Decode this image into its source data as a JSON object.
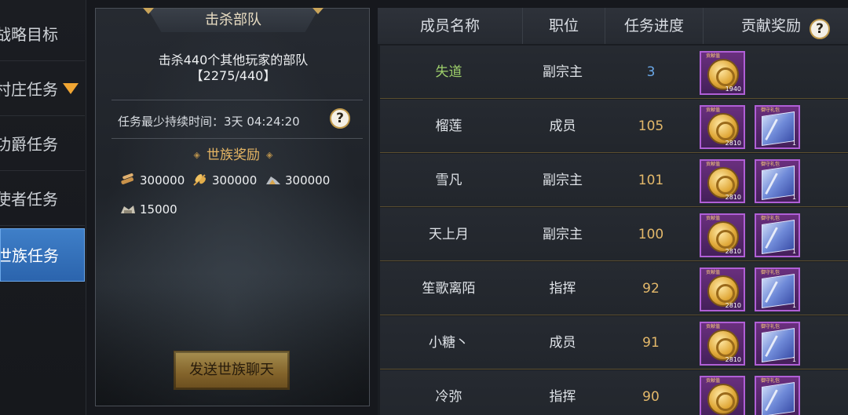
{
  "tabs": [
    {
      "label": "战略目标",
      "active": false
    },
    {
      "label": "村庄任务",
      "active": false,
      "arrow_icon": "dropdown-triangle-icon"
    },
    {
      "label": "功爵任务",
      "active": false
    },
    {
      "label": "使者任务",
      "active": false
    },
    {
      "label": "世族任务",
      "active": true
    }
  ],
  "mission": {
    "title": "击杀部队",
    "description": "击杀440个其他玩家的部队",
    "progress_text": "【2275/440】",
    "duration_text": "任务最少持续时间：3天 04:24:20",
    "help_label": "?",
    "reward_title": "世族奖励",
    "reward_title_ornament": "◈",
    "rewards": [
      {
        "icon": "wood-resource-icon",
        "amount": "300000"
      },
      {
        "icon": "grain-resource-icon",
        "amount": "300000"
      },
      {
        "icon": "stone-resource-icon",
        "amount": "300000"
      },
      {
        "icon": "iron-resource-icon",
        "amount": "15000"
      }
    ],
    "send_button": "发送世族聊天"
  },
  "table": {
    "headers": [
      "成员名称",
      "职位",
      "任务进度",
      "贡献奖励"
    ],
    "help_label": "?",
    "rows": [
      {
        "name": "失道",
        "position": "副宗主",
        "progress": "3",
        "rewards": [
          {
            "icon": "gold-coin-icon",
            "label": "贡献值",
            "count": "1940"
          }
        ]
      },
      {
        "name": "榴莲",
        "position": "成员",
        "progress": "105",
        "rewards": [
          {
            "icon": "gold-coin-icon",
            "label": "贡献值",
            "count": "2810"
          },
          {
            "icon": "gift-book-icon",
            "label": "御守礼包",
            "count": "1"
          }
        ]
      },
      {
        "name": "雪凡",
        "position": "副宗主",
        "progress": "101",
        "rewards": [
          {
            "icon": "gold-coin-icon",
            "label": "贡献值",
            "count": "2810"
          },
          {
            "icon": "gift-book-icon",
            "label": "御守礼包",
            "count": "1"
          }
        ]
      },
      {
        "name": "天上月",
        "position": "副宗主",
        "progress": "100",
        "rewards": [
          {
            "icon": "gold-coin-icon",
            "label": "贡献值",
            "count": "2810"
          },
          {
            "icon": "gift-book-icon",
            "label": "御守礼包",
            "count": "1"
          }
        ]
      },
      {
        "name": "笙歌离陌",
        "position": "指挥",
        "progress": "92",
        "rewards": [
          {
            "icon": "gold-coin-icon",
            "label": "贡献值",
            "count": "2810"
          },
          {
            "icon": "gift-book-icon",
            "label": "御守礼包",
            "count": "1"
          }
        ]
      },
      {
        "name": "小糖丶",
        "position": "成员",
        "progress": "91",
        "rewards": [
          {
            "icon": "gold-coin-icon",
            "label": "贡献值",
            "count": "2810"
          },
          {
            "icon": "gift-book-icon",
            "label": "御守礼包",
            "count": "1"
          }
        ]
      },
      {
        "name": "冷弥",
        "position": "指挥",
        "progress": "90",
        "rewards": [
          {
            "icon": "gold-coin-icon",
            "label": "贡献值",
            "count": ""
          },
          {
            "icon": "gift-book-icon",
            "label": "御守礼包",
            "count": ""
          }
        ]
      }
    ]
  },
  "colors": {
    "active_tab": "#3573bd",
    "gold_text": "#e3b86a",
    "green_name": "#9ed06b",
    "blue_progress": "#6aa7e6",
    "item_border": "#b05fd6"
  }
}
